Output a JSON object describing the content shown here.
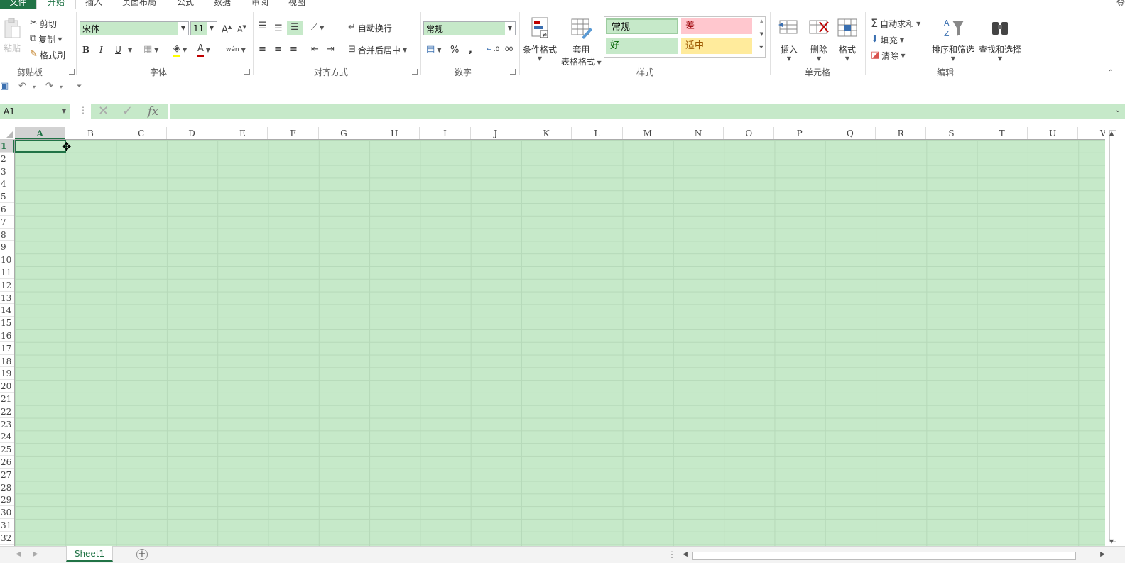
{
  "ribbon_tabs": {
    "file": "文件",
    "home": "开始",
    "insert": "插入",
    "page_layout": "页面布局",
    "formulas": "公式",
    "data": "数据",
    "review": "审阅",
    "view": "视图",
    "login": "登"
  },
  "clipboard": {
    "paste": "粘贴",
    "cut": "剪切",
    "copy": "复制",
    "format_painter": "格式刷",
    "group": "剪贴板"
  },
  "font": {
    "name": "宋体",
    "size": "11",
    "bold": "B",
    "italic": "I",
    "underline": "U",
    "phonetic": "wén",
    "group": "字体"
  },
  "alignment": {
    "wrap_text": "自动换行",
    "merge_center": "合并后居中",
    "group": "对齐方式"
  },
  "number": {
    "format": "常规",
    "percent": "%",
    "comma": ",",
    "inc_decimal": ".0",
    "dec_decimal": ".00",
    "group": "数字"
  },
  "styles": {
    "conditional_formatting": "条件格式",
    "format_as_table_line1": "套用",
    "format_as_table_line2": "表格格式",
    "normal": "常规",
    "bad": "差",
    "good": "好",
    "neutral": "适中",
    "group": "样式"
  },
  "cells_group": {
    "insert": "插入",
    "delete": "删除",
    "format": "格式",
    "group": "单元格"
  },
  "editing": {
    "autosum": "自动求和",
    "fill": "填充",
    "clear": "清除",
    "sort_filter": "排序和筛选",
    "find_select": "查找和选择",
    "group": "编辑"
  },
  "formula_bar": {
    "name_box": "A1",
    "fx": "fx",
    "content": ""
  },
  "grid": {
    "columns": [
      "A",
      "B",
      "C",
      "D",
      "E",
      "F",
      "G",
      "H",
      "I",
      "J",
      "K",
      "L",
      "M",
      "N",
      "O",
      "P",
      "Q",
      "R",
      "S",
      "T",
      "U",
      "V"
    ],
    "rows": [
      "1",
      "2",
      "3",
      "4",
      "5",
      "6",
      "7",
      "8",
      "9",
      "10",
      "11",
      "12",
      "13",
      "14",
      "15",
      "16",
      "17",
      "18",
      "19",
      "20",
      "21",
      "22",
      "23",
      "24",
      "25",
      "26",
      "27",
      "28",
      "29",
      "30",
      "31",
      "32"
    ],
    "selected_column": "A",
    "selected_row": "1"
  },
  "sheets": {
    "tabs": [
      "Sheet1"
    ],
    "active": "Sheet1"
  },
  "colors": {
    "accent": "#217346",
    "eye_protect_green": "#c6e9c9",
    "bad_bg": "#ffc7ce",
    "bad_fg": "#9c0006",
    "good_bg": "#c6efce",
    "good_fg": "#006100",
    "neutral_bg": "#ffeb9c",
    "neutral_fg": "#9c5700"
  }
}
